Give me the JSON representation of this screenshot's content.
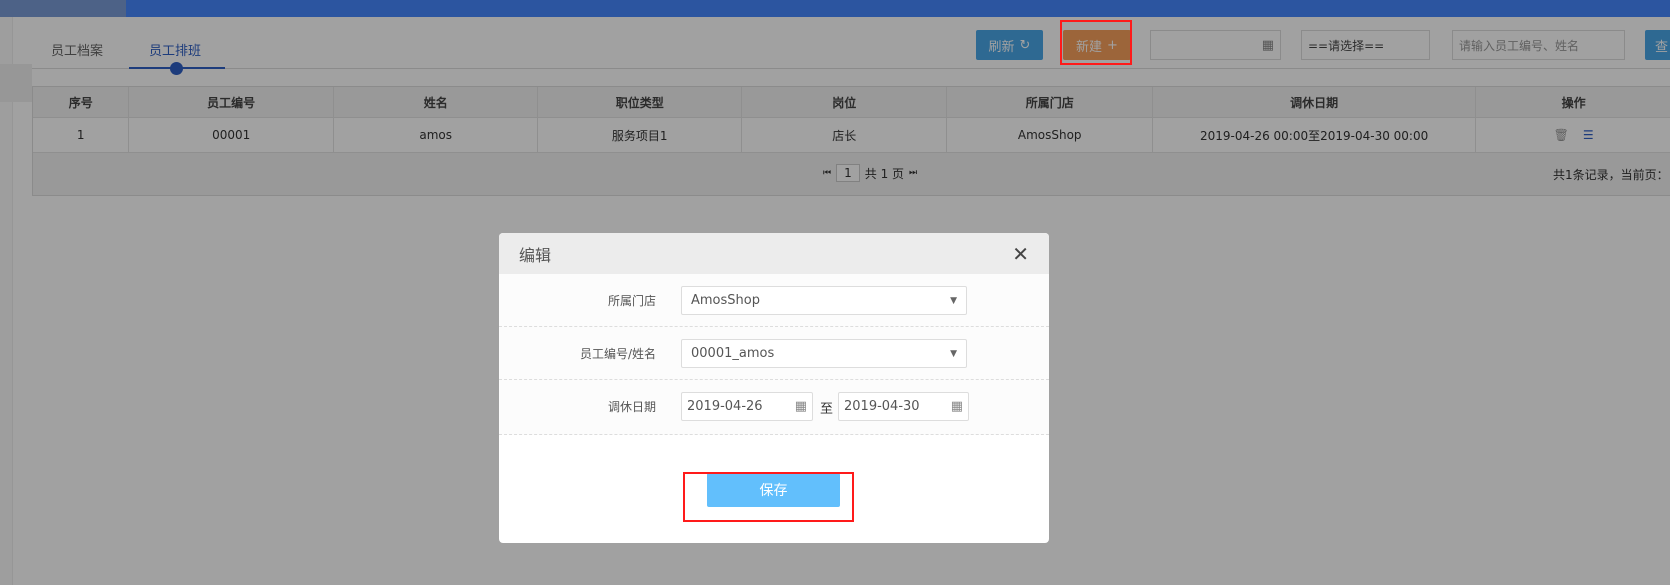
{
  "tabs": [
    {
      "label": "员工档案"
    },
    {
      "label": "员工排班"
    }
  ],
  "toolbar": {
    "refresh_label": "刷新",
    "refresh_icon": "↻",
    "new_label": "新建",
    "new_icon": "+",
    "select_value": "==请选择==",
    "search_placeholder": "请输入员工编号、姓名",
    "query_label": "查"
  },
  "table": {
    "headers": [
      "序号",
      "员工编号",
      "姓名",
      "职位类型",
      "岗位",
      "所属门店",
      "调休日期",
      "操作"
    ],
    "rows": [
      [
        "1",
        "00001",
        "amos",
        "服务项目1",
        "店长",
        "AmosShop",
        "2019-04-26 00:00至2019-04-30 00:00"
      ]
    ],
    "pager": {
      "page": "1",
      "total": "共 1 页",
      "summary": "共1条记录，当前页："
    }
  },
  "dialog": {
    "title": "编辑",
    "store_label": "所属门店",
    "store_value": "AmosShop",
    "employee_label": "员工编号/姓名",
    "employee_value": "00001_amos",
    "date_label": "调休日期",
    "date_from": "2019-04-26",
    "date_sep": "至",
    "date_to": "2019-04-30",
    "save_label": "保存"
  }
}
